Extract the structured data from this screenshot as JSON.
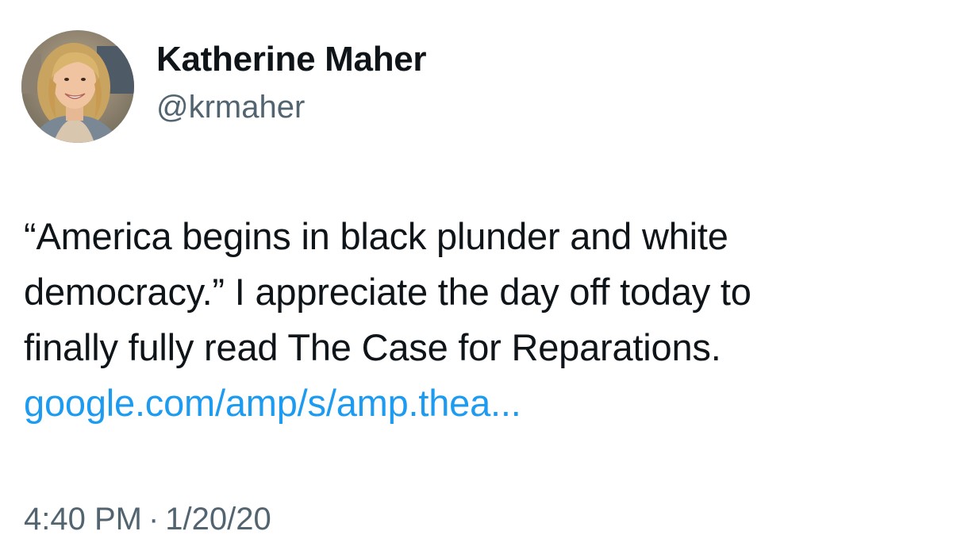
{
  "author": {
    "display_name": "Katherine Maher",
    "handle": "@krmaher",
    "avatar_icon": "profile-photo"
  },
  "tweet": {
    "text_lines": [
      "“America begins in black plunder and white",
      "democracy.” I appreciate the day off today to",
      "finally fully read The Case for Reparations."
    ],
    "link_text": "google.com/amp/s/amp.thea...",
    "time": "4:40 PM",
    "separator": "·",
    "date": "1/20/20"
  },
  "colors": {
    "text": "#0f1419",
    "secondary": "#536471",
    "link": "#1d9bf0",
    "background": "#ffffff"
  }
}
